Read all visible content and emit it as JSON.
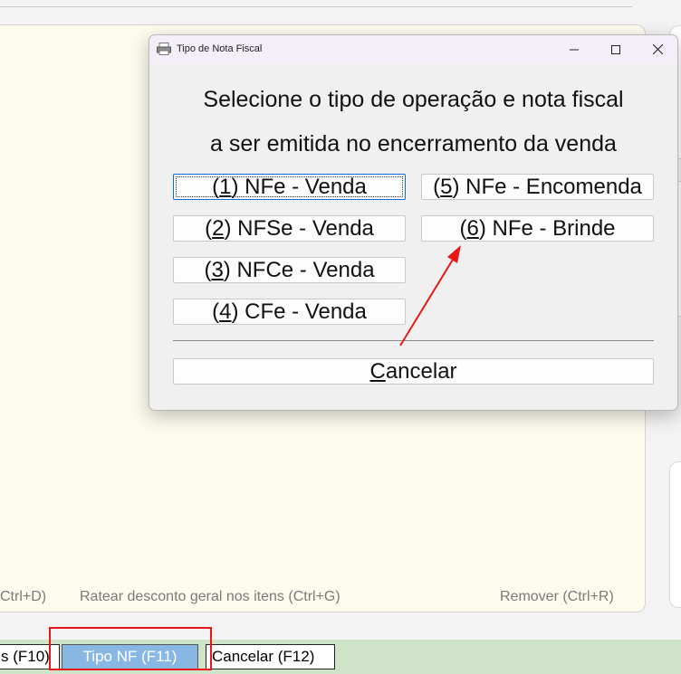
{
  "dialog": {
    "title": "Tipo de Nota Fiscal",
    "heading_line1": "Selecione o tipo de operação e nota fiscal",
    "heading_line2": "a ser emitida no encerramento da venda",
    "options": [
      {
        "key": "1",
        "rest": " NFe - Venda"
      },
      {
        "key": "2",
        "rest": " NFSe - Venda"
      },
      {
        "key": "3",
        "rest": " NFCe - Venda"
      },
      {
        "key": "4",
        "rest": " CFe - Venda"
      },
      {
        "key": "5",
        "rest": " NFe - Encomenda"
      },
      {
        "key": "6",
        "rest": " NFe - Brinde"
      }
    ],
    "cancel_underlined": "C",
    "cancel_rest": "ancelar"
  },
  "hints": {
    "left": "Ctrl+D)",
    "middle": "Ratear desconto geral nos itens (Ctrl+G)",
    "right": "Remover (Ctrl+R)"
  },
  "function_keys": {
    "f10": "s (F10)",
    "f11": "Tipo NF (F11)",
    "f12": "Cancelar (F12)"
  },
  "colors": {
    "accent_red": "#e81616",
    "active_key": "#88b7e3",
    "bottom_bar": "#cfe3c9",
    "panel_bg": "#fdfbee"
  },
  "icons": [
    "printer-icon",
    "minimize-icon",
    "maximize-icon",
    "close-icon"
  ]
}
